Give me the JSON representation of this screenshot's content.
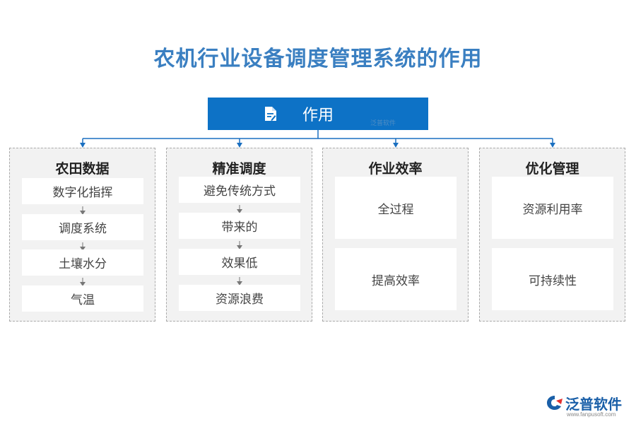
{
  "title": "农机行业设备调度管理系统的作用",
  "root": {
    "label": "作用",
    "icon": "document-edit-icon"
  },
  "columns": [
    {
      "title": "农田数据",
      "items": [
        "数字化指挥",
        "调度系统",
        "土壤水分",
        "气温"
      ]
    },
    {
      "title": "精准调度",
      "items": [
        "避免传统方式",
        "带来的",
        "效果低",
        "资源浪费"
      ]
    },
    {
      "title": "作业效率",
      "items": [
        "全过程",
        "提高效率"
      ]
    },
    {
      "title": "优化管理",
      "items": [
        "资源利用率",
        "可持续性"
      ]
    }
  ],
  "watermark": "泛普软件",
  "logo": {
    "name": "泛普软件",
    "url": "www.fanpusoft.com"
  },
  "colors": {
    "title": "#3a7fc1",
    "root_bg": "#0d72c6",
    "connector": "#1a6fc0",
    "column_bg": "#f2f2f2"
  }
}
